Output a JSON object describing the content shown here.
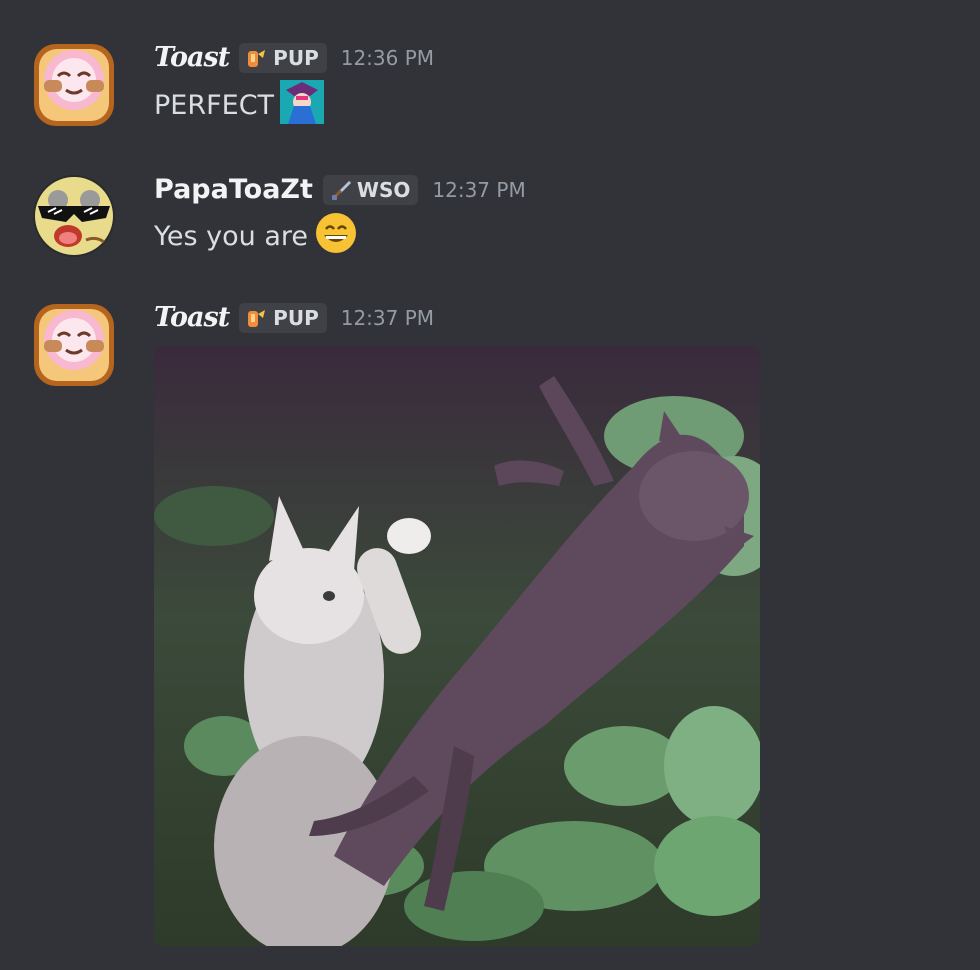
{
  "messages": [
    {
      "author": "Toast",
      "tag": "PUP",
      "tag_icon": "fire-hand-icon",
      "timestamp": "12:36 PM",
      "text": "PERFECT",
      "emoji": "anime-character-emoji"
    },
    {
      "author": "PapaToaZt",
      "tag": "WSO",
      "tag_icon": "sword-icon",
      "timestamp": "12:37 PM",
      "text": "Yes you are",
      "emoji": "grinning-face-emoji"
    },
    {
      "author": "Toast",
      "tag": "PUP",
      "tag_icon": "fire-hand-icon",
      "timestamp": "12:37 PM",
      "attachment": "image-attachment"
    }
  ],
  "colors": {
    "background": "#313338",
    "username": "#f2f3f5",
    "timestamp": "#949ba4",
    "tag_bg": "#3f4147"
  }
}
